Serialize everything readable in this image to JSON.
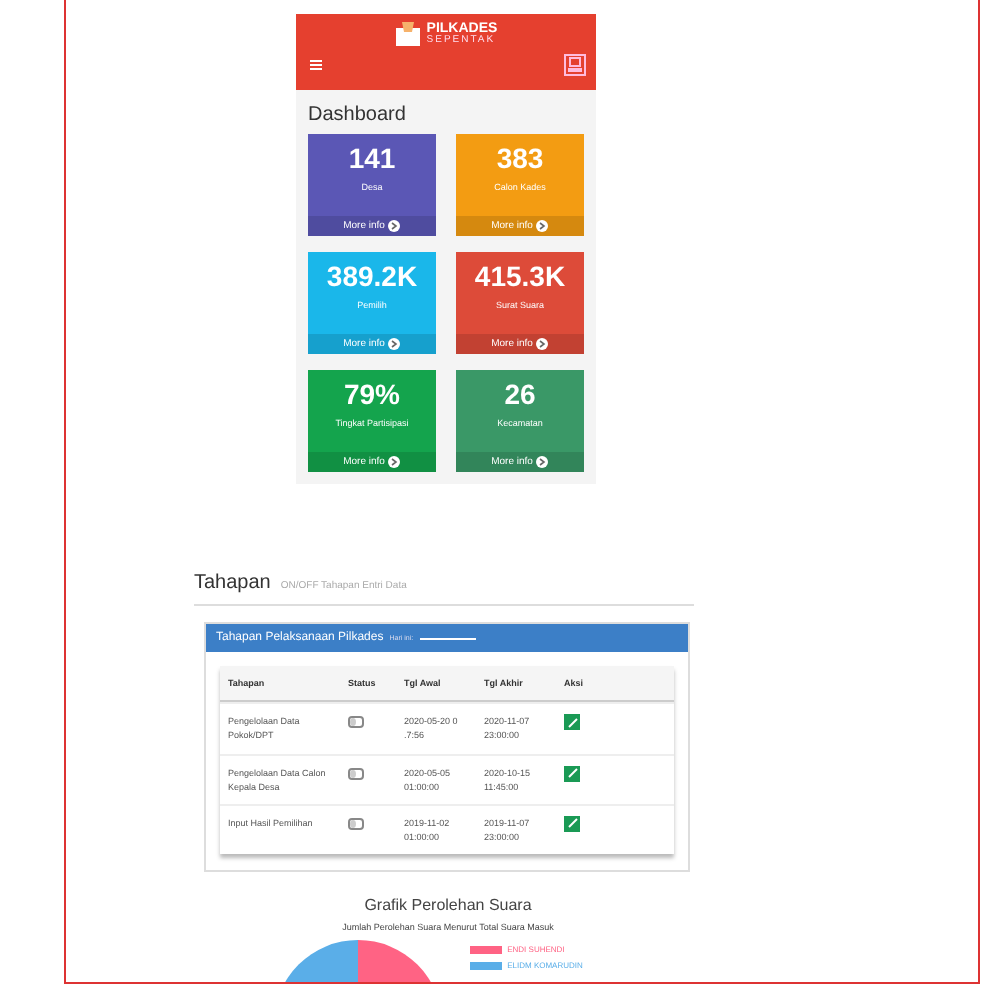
{
  "header": {
    "logo_title": "PILKADES",
    "logo_subtitle": "SEPENTAK"
  },
  "dashboard": {
    "title": "Dashboard",
    "tiles": [
      {
        "value": "141",
        "label": "Desa",
        "link": "More info",
        "color": "#5b57b5"
      },
      {
        "value": "383",
        "label": "Calon Kades",
        "link": "More info",
        "color": "#f39c12"
      },
      {
        "value": "389.2K",
        "label": "Pemilih",
        "link": "More info",
        "color": "#1ab7ea"
      },
      {
        "value": "415.3K",
        "label": "Surat Suara",
        "link": "More info",
        "color": "#dd4b39"
      },
      {
        "value": "79%",
        "label": "Tingkat Partisipasi",
        "link": "More info",
        "color": "#14a44d"
      },
      {
        "value": "26",
        "label": "Kecamatan",
        "link": "More info",
        "color": "#3a9867"
      }
    ]
  },
  "tahapan": {
    "title": "Tahapan",
    "subtitle": "ON/OFF Tahapan Entri Data",
    "panel_title": "Tahapan Pelaksanaan Pilkades",
    "panel_note": "Hari ini:",
    "columns": [
      "Tahapan",
      "Status",
      "Tgl Awal",
      "Tgl Akhir",
      "Aksi"
    ],
    "rows": [
      {
        "tahapan": "Pengelolaan Data Pokok/DPT",
        "on": false,
        "tgl_awal": "2020-05-20 0 .7:56",
        "tgl_akhir": "2020-11-07 23:00:00"
      },
      {
        "tahapan": "Pengelolaan Data Calon Kepala Desa",
        "on": false,
        "tgl_awal": "2020-05-05 01:00:00",
        "tgl_akhir": "2020-10-15 11:45:00"
      },
      {
        "tahapan": "Input Hasil Pemilihan",
        "on": false,
        "tgl_awal": "2019-11-02 01:00:00",
        "tgl_akhir": "2019-11-07 23:00:00"
      }
    ]
  },
  "grafik": {
    "title": "Grafik Perolehan Suara",
    "subtitle": "Jumlah Perolehan Suara Menurut Total Suara Masuk",
    "legend": [
      {
        "label": "ENDI SUHENDI",
        "color": "#ff6384"
      },
      {
        "label": "ELIDM KOMARUDIN",
        "color": "#5aaee8"
      }
    ]
  }
}
